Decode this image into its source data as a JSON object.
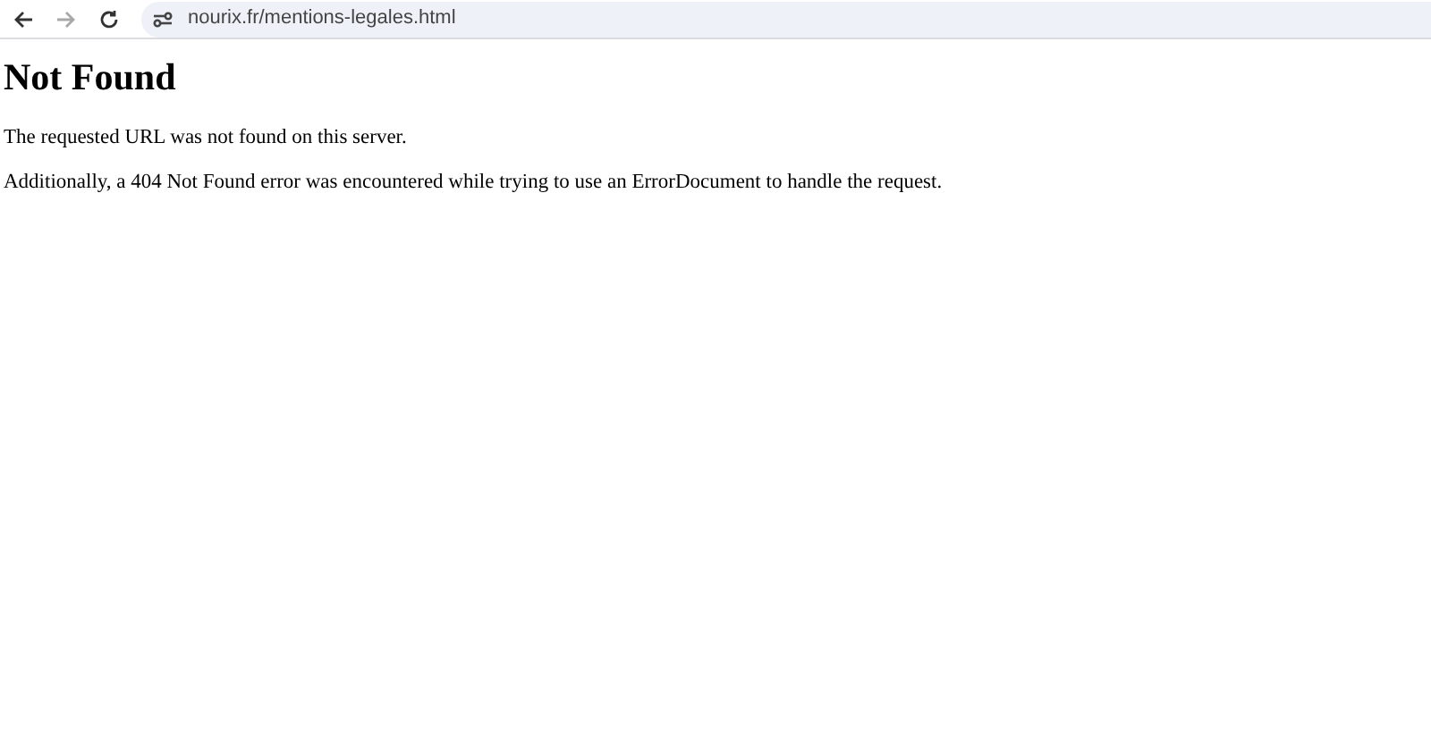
{
  "toolbar": {
    "buttons": [
      {
        "kind": "back",
        "disabled": false
      },
      {
        "kind": "forward",
        "disabled": true
      },
      {
        "kind": "reload",
        "disabled": false
      }
    ],
    "address": "nourix.fr/mentions-legales.html"
  },
  "page": {
    "heading": "Not Found",
    "paragraphs": [
      "The requested URL was not found on this server.",
      "Additionally, a 404 Not Found error was encountered while trying to use an ErrorDocument to handle the request."
    ]
  }
}
